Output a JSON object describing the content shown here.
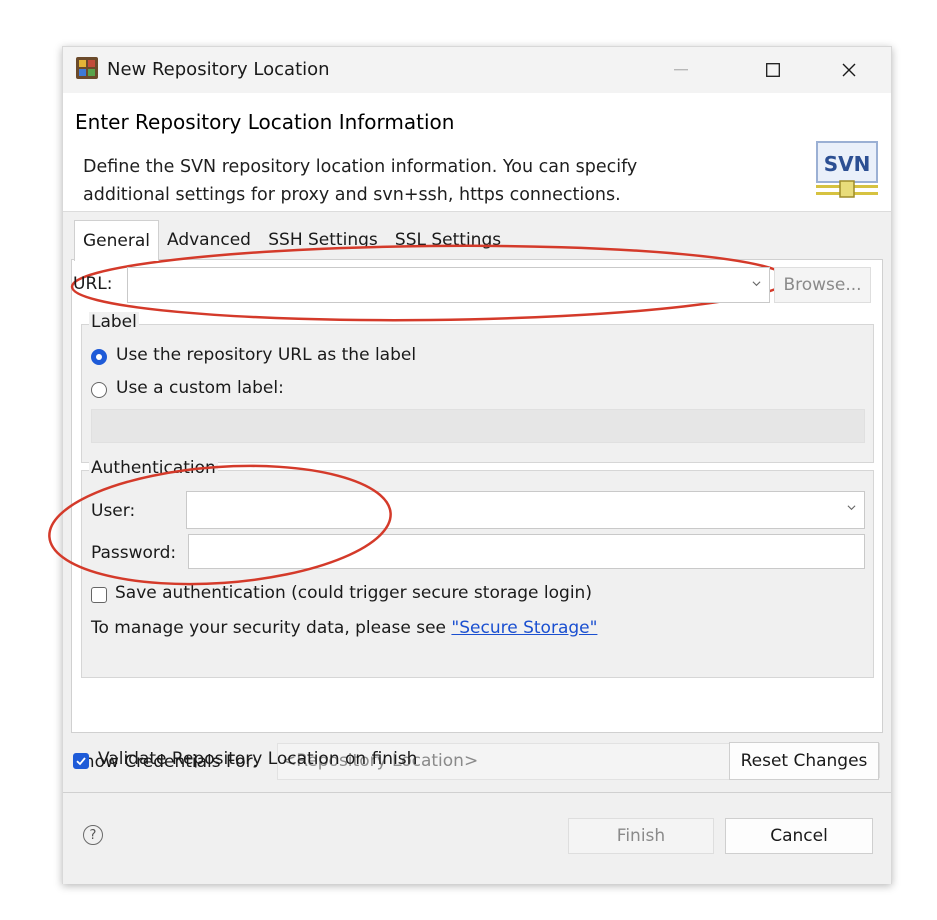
{
  "window": {
    "title": "New Repository Location",
    "minimize_label": "—",
    "maximize_label": "☐",
    "close_label": "✕"
  },
  "header": {
    "title": "Enter Repository Location Information",
    "description": "Define the SVN repository location information. You can specify\nadditional settings for proxy and svn+ssh, https connections.",
    "logo_text": "SVN"
  },
  "tabs": [
    {
      "label": "General",
      "active": true
    },
    {
      "label": "Advanced",
      "active": false
    },
    {
      "label": "SSH Settings",
      "active": false
    },
    {
      "label": "SSL Settings",
      "active": false
    }
  ],
  "general": {
    "url_label": "URL:",
    "url_value": "",
    "browse_label": "Browse...",
    "label_group_title": "Label",
    "radio_repo_url": "Use the repository URL as the label",
    "radio_custom": "Use a custom label:",
    "custom_label_value": "",
    "auth_group_title": "Authentication",
    "user_label": "User:",
    "user_value": "",
    "password_label": "Password:",
    "password_value": "",
    "save_auth_label": "Save authentication (could trigger secure storage login)",
    "manage_text": "To manage your security data, please see ",
    "secure_storage_link": "\"Secure Storage\""
  },
  "credentials": {
    "label": "Show Credentials For:",
    "value": "<Repository Location>"
  },
  "validate_label": "Validate Repository Location on finish",
  "reset_label": "Reset Changes",
  "footer": {
    "help_symbol": "?",
    "finish_label": "Finish",
    "cancel_label": "Cancel"
  },
  "colors": {
    "accent": "#1e5bd8",
    "annotation": "#d43a2a",
    "link": "#1a4fd0"
  }
}
